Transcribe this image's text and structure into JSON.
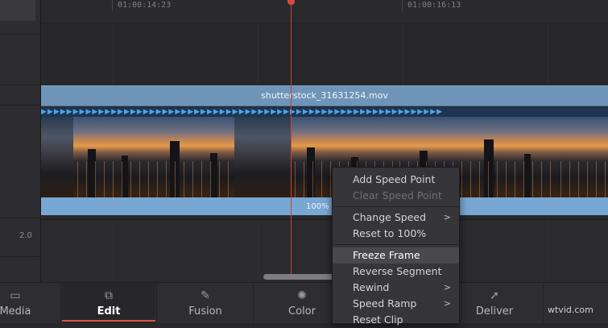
{
  "timeline": {
    "timecodes": [
      "01:00:14:23",
      "01:00:16:13"
    ],
    "clip_name": "shutterstock_31631254.mov",
    "speed_percent": "100%",
    "track_label": "2.0"
  },
  "context_menu": {
    "items": [
      {
        "label": "Add Speed Point",
        "disabled": false,
        "submenu": false,
        "highlighted": false
      },
      {
        "label": "Clear Speed Point",
        "disabled": true,
        "submenu": false,
        "highlighted": false
      },
      {
        "label": "Change Speed",
        "disabled": false,
        "submenu": true,
        "highlighted": false
      },
      {
        "label": "Reset to 100%",
        "disabled": false,
        "submenu": false,
        "highlighted": false
      },
      {
        "label": "Freeze Frame",
        "disabled": false,
        "submenu": false,
        "highlighted": true
      },
      {
        "label": "Reverse Segment",
        "disabled": false,
        "submenu": false,
        "highlighted": false
      },
      {
        "label": "Rewind",
        "disabled": false,
        "submenu": true,
        "highlighted": false
      },
      {
        "label": "Speed Ramp",
        "disabled": false,
        "submenu": true,
        "highlighted": false
      },
      {
        "label": "Reset Clip",
        "disabled": false,
        "submenu": false,
        "highlighted": false
      }
    ],
    "submenu_arrow": ">"
  },
  "pages": [
    {
      "label": "Media",
      "icon": "media-icon",
      "active": false
    },
    {
      "label": "Edit",
      "icon": "edit-icon",
      "active": true
    },
    {
      "label": "Fusion",
      "icon": "fusion-icon",
      "active": false
    },
    {
      "label": "Color",
      "icon": "color-icon",
      "active": false
    },
    {
      "label": "Deliver",
      "icon": "deliver-icon",
      "active": false
    }
  ],
  "watermark": "wtvid.com",
  "colors": {
    "clip_header": "#6e95b8",
    "speed_bar": "#79a7d3",
    "playhead": "#c8423a",
    "active_page_underline": "#e0533f"
  }
}
